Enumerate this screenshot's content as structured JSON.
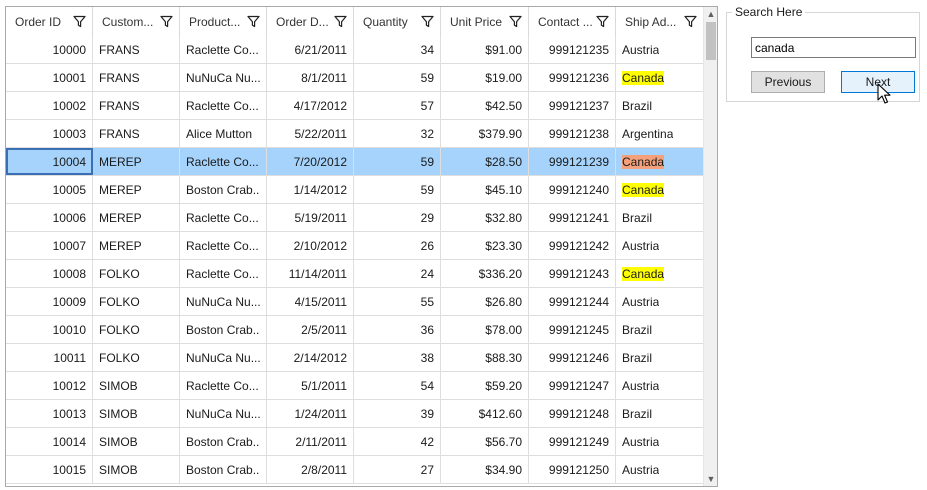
{
  "grid": {
    "columns": [
      {
        "label": "Order ID",
        "align": "right"
      },
      {
        "label": "Custom...",
        "align": "left"
      },
      {
        "label": "Product...",
        "align": "left"
      },
      {
        "label": "Order D...",
        "align": "right"
      },
      {
        "label": "Quantity",
        "align": "right"
      },
      {
        "label": "Unit Price",
        "align": "right"
      },
      {
        "label": "Contact ...",
        "align": "right"
      },
      {
        "label": "Ship Ad...",
        "align": "left"
      }
    ],
    "rows": [
      [
        "10000",
        "FRANS",
        "Raclette  Co...",
        "6/21/2011",
        "34",
        "$91.00",
        "999121235",
        "Austria"
      ],
      [
        "10001",
        "FRANS",
        "NuNuCa  Nu...",
        "8/1/2011",
        "59",
        "$19.00",
        "999121236",
        "Canada"
      ],
      [
        "10002",
        "FRANS",
        "Raclette  Co...",
        "4/17/2012",
        "57",
        "$42.50",
        "999121237",
        "Brazil"
      ],
      [
        "10003",
        "FRANS",
        "Alice Mutton",
        "5/22/2011",
        "32",
        "$379.90",
        "999121238",
        "Argentina"
      ],
      [
        "10004",
        "MEREP",
        "Raclette  Co...",
        "7/20/2012",
        "59",
        "$28.50",
        "999121239",
        "Canada"
      ],
      [
        "10005",
        "MEREP",
        "Boston  Crab...",
        "1/14/2012",
        "59",
        "$45.10",
        "999121240",
        "Canada"
      ],
      [
        "10006",
        "MEREP",
        "Raclette  Co...",
        "5/19/2011",
        "29",
        "$32.80",
        "999121241",
        "Brazil"
      ],
      [
        "10007",
        "MEREP",
        "Raclette  Co...",
        "2/10/2012",
        "26",
        "$23.30",
        "999121242",
        "Austria"
      ],
      [
        "10008",
        "FOLKO",
        "Raclette  Co...",
        "11/14/2011",
        "24",
        "$336.20",
        "999121243",
        "Canada"
      ],
      [
        "10009",
        "FOLKO",
        "NuNuCa  Nu...",
        "4/15/2011",
        "55",
        "$26.80",
        "999121244",
        "Austria"
      ],
      [
        "10010",
        "FOLKO",
        "Boston  Crab...",
        "2/5/2011",
        "36",
        "$78.00",
        "999121245",
        "Brazil"
      ],
      [
        "10011",
        "FOLKO",
        "NuNuCa  Nu...",
        "2/14/2012",
        "38",
        "$88.30",
        "999121246",
        "Brazil"
      ],
      [
        "10012",
        "SIMOB",
        "Raclette  Co...",
        "5/1/2011",
        "54",
        "$59.20",
        "999121247",
        "Austria"
      ],
      [
        "10013",
        "SIMOB",
        "NuNuCa  Nu...",
        "1/24/2011",
        "39",
        "$412.60",
        "999121248",
        "Brazil"
      ],
      [
        "10014",
        "SIMOB",
        "Boston  Crab...",
        "2/11/2011",
        "42",
        "$56.70",
        "999121249",
        "Austria"
      ],
      [
        "10015",
        "SIMOB",
        "Boston  Crab...",
        "2/8/2011",
        "27",
        "$34.90",
        "999121250",
        "Austria"
      ]
    ],
    "selected_row_index": 4,
    "search_match_text": "Canada",
    "colors": {
      "selected_row": "#a6d3fb",
      "match_highlight": "#ffff00",
      "current_match_highlight": "#f4a07a"
    }
  },
  "search": {
    "group_title": "Search Here",
    "input_value": "canada",
    "previous_label": "Previous",
    "next_label": "Next"
  },
  "icons": {
    "column_filter": "filter-icon",
    "scroll_up": "chevron-up-icon",
    "scroll_down": "chevron-down-icon",
    "pointer": "mouse-cursor-icon"
  }
}
